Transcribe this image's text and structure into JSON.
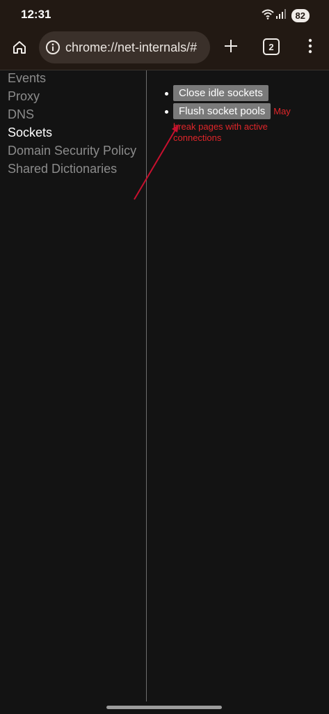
{
  "status_bar": {
    "time": "12:31",
    "battery": "82",
    "icons": [
      "wifi-icon",
      "signal-icon",
      "battery-icon"
    ]
  },
  "toolbar": {
    "url": "chrome://net-internals/#",
    "tab_count": "2",
    "icons": [
      "home-icon",
      "info-icon",
      "plus-icon",
      "tab-switcher-icon",
      "more-vert-icon"
    ]
  },
  "sidebar": {
    "items": [
      {
        "label": "Events",
        "active": false
      },
      {
        "label": "Proxy",
        "active": false
      },
      {
        "label": "DNS",
        "active": false
      },
      {
        "label": "Sockets",
        "active": true
      },
      {
        "label": "Domain Security Policy",
        "active": false
      },
      {
        "label": "Shared Dictionaries",
        "active": false
      }
    ]
  },
  "sockets": {
    "close_idle_label": "Close idle sockets",
    "flush_pools_label": "Flush socket pools",
    "warning_first": "May",
    "warning_rest": "break pages with active connections"
  },
  "colors": {
    "background": "#131313",
    "chrome": "#221913",
    "button": "#7a7a7a",
    "warning": "#e0262a",
    "annotation": "#c8102e"
  }
}
